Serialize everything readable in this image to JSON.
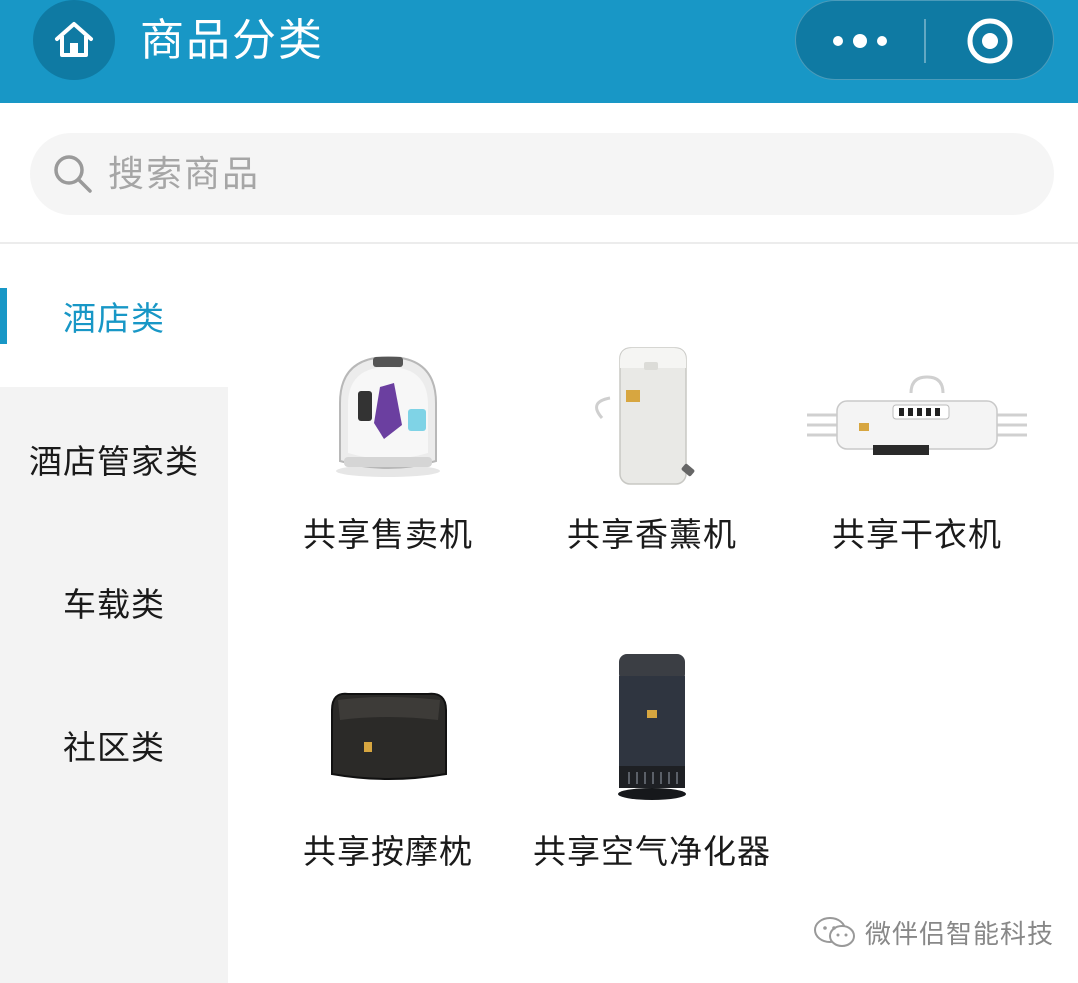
{
  "header": {
    "title": "商品分类",
    "home_icon": "home-icon",
    "more_icon": "more-dots-icon",
    "close_icon": "mini-program-close-icon",
    "bg_color": "#1897c6"
  },
  "search": {
    "placeholder": "搜索商品",
    "icon": "search-icon"
  },
  "sidebar": {
    "items": [
      {
        "label": "酒店类",
        "active": true
      },
      {
        "label": "酒店管家类",
        "active": false
      },
      {
        "label": "车载类",
        "active": false
      },
      {
        "label": "社区类",
        "active": false
      }
    ],
    "accent_color": "#1897c6"
  },
  "products": [
    {
      "name": "共享售卖机",
      "icon": "vending-machine-image"
    },
    {
      "name": "共享香薰机",
      "icon": "aroma-diffuser-image"
    },
    {
      "name": "共享干衣机",
      "icon": "clothes-dryer-image"
    },
    {
      "name": "共享按摩枕",
      "icon": "massage-pillow-image"
    },
    {
      "name": "共享空气净化器",
      "icon": "air-purifier-image"
    }
  ],
  "watermark": {
    "text": "微伴侣智能科技",
    "icon": "wechat-official-account-icon"
  }
}
